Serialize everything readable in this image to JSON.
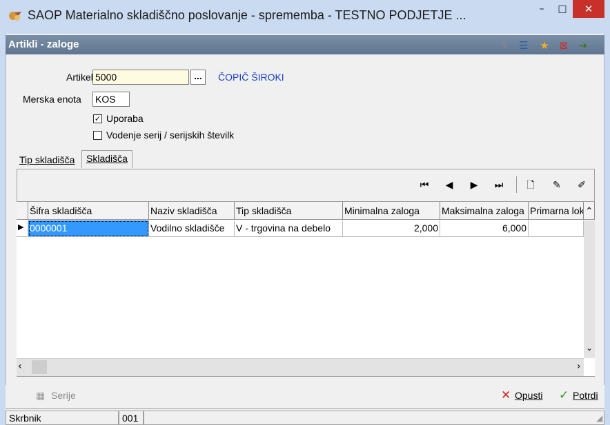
{
  "window": {
    "title": "SAOP Materialno skladiščno poslovanje - sprememba - TESTNO PODJETJE ...",
    "minimize": "–",
    "maximize": "□",
    "close": "✕"
  },
  "form": {
    "title": "Artikli - zaloge"
  },
  "fields": {
    "artikel_label": "Artikel",
    "artikel_value": "5000",
    "browse_label": "...",
    "artikel_name": "ČOPIČ ŠIROKI",
    "merska_label": "Merska enota",
    "merska_value": "KOS",
    "uporaba_label": "Uporaba",
    "uporaba_checked": "✓",
    "serije_label": "Vodenje serij / serijskih številk"
  },
  "tabs": [
    {
      "label": "Tip skladišča"
    },
    {
      "label": "Skladišča"
    }
  ],
  "grid": {
    "columns": [
      "Šifra skladišča",
      "Naziv skladišča",
      "Tip skladišča",
      "Minimalna zaloga",
      "Maksimalna zaloga",
      "Primarna loka"
    ],
    "rows": [
      [
        "0000001",
        "Vodilno skladišče",
        "V - trgovina na debelo",
        "2,000",
        "6,000",
        ""
      ]
    ]
  },
  "footer": {
    "serije": "Serije",
    "opusti": "Opusti",
    "potrdi": "Potrdi"
  },
  "status": {
    "user": "Skrbnik",
    "code": "001"
  }
}
